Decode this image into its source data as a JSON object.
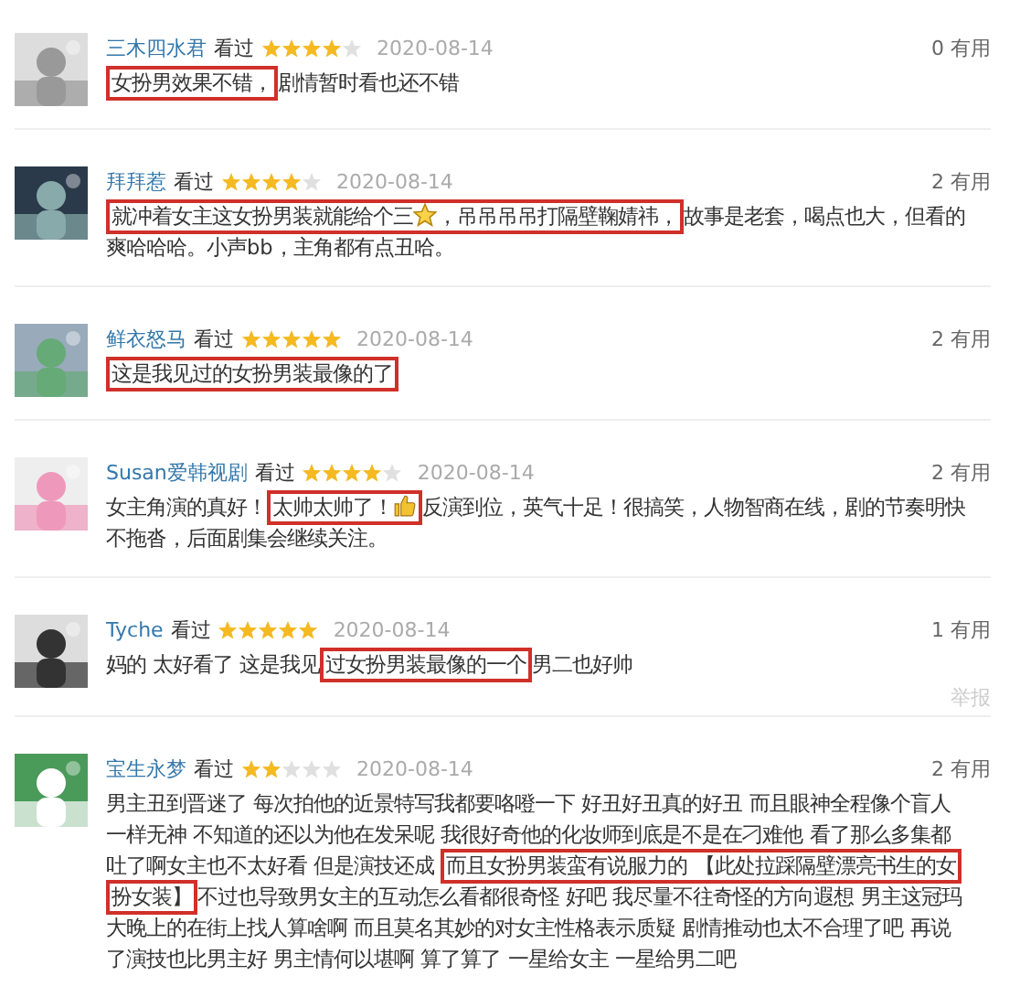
{
  "reviews": [
    {
      "avatar": {
        "kind": "picture"
      },
      "user": "三木四水君",
      "status": "看过",
      "stars": 4,
      "date": "2020-08-14",
      "votes": "0 有用",
      "segments": [
        {
          "kind": "text",
          "text": "女扮男效果不错，",
          "highlighted": true
        },
        {
          "kind": "text",
          "text": "剧情暂时看也还不错",
          "highlighted": false
        }
      ]
    },
    {
      "avatar": {
        "kind": "picture"
      },
      "user": "拜拜惹",
      "status": "看过",
      "stars": 4,
      "date": "2020-08-14",
      "votes": "2 有用",
      "segments": [
        {
          "kind": "text",
          "text": "就冲着女主这女扮男装就能给个三",
          "highlighted": true
        },
        {
          "kind": "star",
          "highlighted": true
        },
        {
          "kind": "text",
          "text": "，吊吊吊吊打隔壁鞠婧祎，",
          "highlighted": true
        },
        {
          "kind": "text",
          "text": "故事是老套，喝点也大，但看的爽哈哈哈。小声bb，主角都有点丑哈。",
          "highlighted": false
        }
      ]
    },
    {
      "avatar": {
        "kind": "picture"
      },
      "user": "鲜衣怒马",
      "status": "看过",
      "stars": 5,
      "date": "2020-08-14",
      "votes": "2 有用",
      "segments": [
        {
          "kind": "text",
          "text": "这是我见过的女扮男装最像的了",
          "highlighted": true
        }
      ]
    },
    {
      "avatar": {
        "kind": "picture"
      },
      "user": "Susan爱韩视剧",
      "status": "看过",
      "stars": 4,
      "date": "2020-08-14",
      "votes": "2 有用",
      "segments": [
        {
          "kind": "text",
          "text": "女主角演的真好！",
          "highlighted": false
        },
        {
          "kind": "text",
          "text": "太帅太帅了！",
          "highlighted": true
        },
        {
          "kind": "thumb",
          "highlighted": true
        },
        {
          "kind": "text",
          "text": "反演到位，英气十足！很搞笑，人物智商在线，剧的节奏明快不拖沓，后面剧集会继续关注。",
          "highlighted": false
        }
      ]
    },
    {
      "avatar": {
        "kind": "picture"
      },
      "user": "Tyche",
      "status": "看过",
      "stars": 5,
      "date": "2020-08-14",
      "votes": "1 有用",
      "report": "举报",
      "segments": [
        {
          "kind": "text",
          "text": "妈的 太好看了 这是我见",
          "highlighted": false
        },
        {
          "kind": "text",
          "text": "过女扮男装最像的一个",
          "highlighted": true
        },
        {
          "kind": "text",
          "text": "男二也好帅",
          "highlighted": false
        }
      ]
    },
    {
      "avatar": {
        "kind": "picture"
      },
      "user": "宝生永梦",
      "status": "看过",
      "stars": 2,
      "date": "2020-08-14",
      "votes": "2 有用",
      "segments": [
        {
          "kind": "text",
          "text": "男主丑到晋迷了 每次拍他的近景特写我都要咯噔一下 好丑好丑真的好丑 而且眼神全程像个盲人一样无神 不知道的还以为他在发呆呢 我很好奇他的化妆师到底是不是在刁难他 看了那么多集都吐了啊女主也不太好看 但是演技还成 ",
          "highlighted": false
        },
        {
          "kind": "text",
          "text": "而且女扮男装蛮有说服力的 【此处拉踩隔壁漂亮书生的女扮女装】",
          "highlighted": true
        },
        {
          "kind": "text",
          "text": "不过也导致男女主的互动怎么看都很奇怪 好吧 我尽量不往奇怪的方向遐想 男主这冠玛大晚上的在街上找人算啥啊 而且莫名其妙的对女主性格表示质疑 剧情推动也太不合理了吧 再说了演技也比男主好 男主情何以堪啊 算了算了 一星给女主 一星给男二吧",
          "highlighted": false
        }
      ]
    }
  ]
}
